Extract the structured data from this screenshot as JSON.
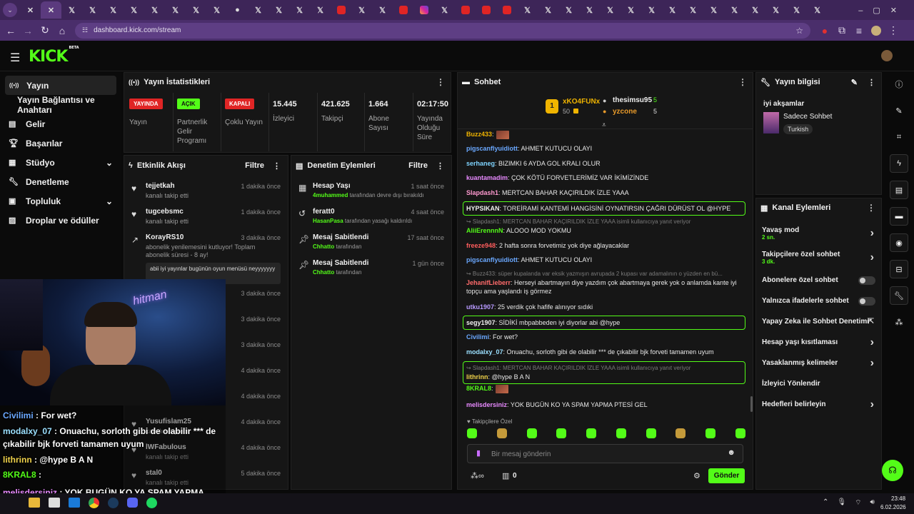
{
  "browser": {
    "tabs": [
      {
        "icon": "tab-icon",
        "g": "✕"
      },
      {
        "icon": "tab-icon",
        "g": "✕"
      },
      {
        "icon": "x-tab-icon",
        "g": "𝕏"
      },
      {
        "icon": "x-tab-icon",
        "g": "𝕏"
      },
      {
        "icon": "x-tab-icon",
        "g": "𝕏"
      },
      {
        "icon": "x-tab-icon",
        "g": "𝕏"
      },
      {
        "icon": "x-tab-icon",
        "g": "𝕏"
      },
      {
        "icon": "x-tab-icon",
        "g": "𝕏"
      },
      {
        "icon": "x-tab-icon",
        "g": "𝕏"
      },
      {
        "icon": "x-tab-icon",
        "g": "𝕏"
      },
      {
        "icon": "avatar-tab-icon",
        "g": "●"
      },
      {
        "icon": "x-tab-icon",
        "g": "𝕏"
      },
      {
        "icon": "x-tab-icon",
        "g": "𝕏"
      },
      {
        "icon": "x-tab-icon",
        "g": "𝕏"
      },
      {
        "icon": "x-tab-icon",
        "g": "𝕏"
      },
      {
        "icon": "youtube-tab-icon",
        "g": "yt"
      },
      {
        "icon": "x-tab-icon",
        "g": "𝕏"
      },
      {
        "icon": "x-tab-icon",
        "g": "𝕏"
      },
      {
        "icon": "youtube-tab-icon",
        "g": "yt"
      },
      {
        "icon": "instagram-tab-icon",
        "g": "ig"
      },
      {
        "icon": "x-tab-icon",
        "g": "𝕏"
      },
      {
        "icon": "youtube-tab-icon",
        "g": "yt"
      },
      {
        "icon": "youtube-tab-icon",
        "g": "yt"
      },
      {
        "icon": "youtube-tab-icon",
        "g": "yt"
      },
      {
        "icon": "x-tab-icon",
        "g": "𝕏"
      },
      {
        "icon": "x-tab-icon",
        "g": "𝕏"
      },
      {
        "icon": "x-tab-icon",
        "g": "𝕏"
      },
      {
        "icon": "x-tab-icon",
        "g": "𝕏"
      },
      {
        "icon": "x-tab-icon",
        "g": "𝕏"
      },
      {
        "icon": "x-tab-icon",
        "g": "𝕏"
      },
      {
        "icon": "x-tab-icon",
        "g": "𝕏"
      },
      {
        "icon": "x-tab-icon",
        "g": "𝕏"
      },
      {
        "icon": "x-tab-icon",
        "g": "𝕏"
      },
      {
        "icon": "x-tab-icon",
        "g": "𝕏"
      },
      {
        "icon": "x-tab-icon",
        "g": "𝕏"
      },
      {
        "icon": "x-tab-icon",
        "g": "𝕏"
      },
      {
        "icon": "x-tab-icon",
        "g": "𝕏"
      },
      {
        "icon": "x-tab-icon",
        "g": "𝕏"
      },
      {
        "icon": "x-tab-icon",
        "g": "𝕏"
      },
      {
        "icon": "new-tab-icon",
        "g": "+"
      }
    ],
    "url": "dashboard.kick.com/stream"
  },
  "app": {
    "logo": "KICK",
    "logo_beta": "BETA"
  },
  "sidebar": {
    "items": [
      {
        "label": "Yayın",
        "icon": "broadcast-icon",
        "glyph": "((•))",
        "active": true
      },
      {
        "label": "Yayın Bağlantısı ve Anahtarı",
        "icon": "",
        "glyph": ""
      },
      {
        "label": "Gelir",
        "icon": "chart-icon",
        "glyph": "▤"
      },
      {
        "label": "Başarılar",
        "icon": "trophy-icon",
        "glyph": "🏆︎"
      },
      {
        "label": "Stüdyo",
        "icon": "studio-icon",
        "glyph": "▦",
        "chevron": "⌄"
      },
      {
        "label": "Denetleme",
        "icon": "wrench-icon",
        "glyph": "🔧︎"
      },
      {
        "label": "Topluluk",
        "icon": "community-icon",
        "glyph": "▣",
        "chevron": "⌄"
      },
      {
        "label": "Droplar ve ödüller",
        "icon": "gift-icon",
        "glyph": "▨"
      }
    ]
  },
  "stats": {
    "title": "Yayın İstatistikleri",
    "items": [
      {
        "badge": "YAYINDA",
        "badge_color": "#e02525",
        "label": "Yayın"
      },
      {
        "badge": "AÇIK",
        "badge_color": "#53fc18",
        "label": "Partnerlik Gelir Programı"
      },
      {
        "badge": "KAPALI",
        "badge_color": "#e02525",
        "label": "Çoklu Yayın"
      },
      {
        "value": "15.445",
        "label": "İzleyici"
      },
      {
        "value": "421.625",
        "label": "Takipçi"
      },
      {
        "value": "1.664",
        "label": "Abone Sayısı"
      },
      {
        "value": "02:17:50",
        "label": "Yayında Olduğu Süre"
      }
    ]
  },
  "activity": {
    "title": "Etkinlik Akışı",
    "filter": "Filtre",
    "items": [
      {
        "name": "tejjetkah",
        "sub": "kanalı takip etti",
        "time": "1 dakika önce"
      },
      {
        "name": "tugcebsmc",
        "sub": "kanalı takip etti",
        "time": "1 dakika önce"
      },
      {
        "name": "KorayRS10",
        "sub": "abonelik yenilemesini kutluyor! Toplam abonelik süresi - 8 ay!",
        "time": "3 dakika önce",
        "msg": "abii iyi yayınlar bugünün oyun menüsü neyyyyyyy"
      },
      {
        "time": "3 dakika önce"
      },
      {
        "time": "3 dakika önce"
      },
      {
        "time": "3 dakika önce"
      },
      {
        "time": "4 dakika önce"
      },
      {
        "name": "",
        "sub": "kanalı takip etti",
        "time": "4 dakika önce"
      },
      {
        "name": "Yusufislam25",
        "sub": "kanalı takip etti",
        "time": "4 dakika önce"
      },
      {
        "name": "lWFabulous",
        "sub": "kanalı takip etti",
        "time": "4 dakika önce"
      },
      {
        "name": "stal0",
        "sub": "kanalı takip etti",
        "time": "5 dakika önce"
      }
    ]
  },
  "moderation": {
    "title": "Denetim Eylemleri",
    "filter": "Filtre",
    "items": [
      {
        "title": "Hesap Yaşı",
        "user": "4muhammed",
        "rest": " tarafından devre dışı bırakıldı",
        "time": "1 saat önce",
        "icon": "calendar-icon",
        "glyph": "▦"
      },
      {
        "title": "feratt0",
        "user": "HasanPasa",
        "rest": " tarafından yasağı kaldırıldı",
        "time": "4 saat önce",
        "icon": "undo-icon",
        "glyph": "↺"
      },
      {
        "title": "Mesaj Sabitlendi",
        "user": "Chhatto",
        "rest": " tarafından",
        "time": "17 saat önce",
        "icon": "pin-icon",
        "glyph": "📌︎"
      },
      {
        "title": "Mesaj Sabitlendi",
        "user": "Chhatto",
        "rest": " tarafından",
        "time": "1 gün önce",
        "icon": "pin-icon",
        "glyph": "📌︎"
      }
    ]
  },
  "chat": {
    "title": "Sohbet",
    "leaders": [
      {
        "rank": "1",
        "name": "xKO4FUNx",
        "count": "50"
      },
      {
        "name": "thesimsu95",
        "count": "5"
      },
      {
        "name": "yzcone",
        "count": "5"
      }
    ],
    "messages": [
      {
        "user": "Buzz433",
        "color": "#f0b400",
        "text": ":",
        "emote": true
      },
      {
        "user": "pigscanflyuidiott",
        "color": "#6aa8ff",
        "text": ": AHMET KUTUCU OLAYI"
      },
      {
        "user": "serhaneg",
        "color": "#7fd4ff",
        "text": ": BIZIMKI 6 AYDA GOL KRALI OLUR"
      },
      {
        "user": "kuantamadim",
        "color": "#e88aff",
        "text": ": ÇOK KÖTÜ FORVETLERİMİZ VAR İKİMİZİNDE"
      },
      {
        "user": "Slapdash1",
        "color": "#ff9ad0",
        "text": ": MERTCAN BAHAR KAÇIRILDIK İZLE YAAA"
      },
      {
        "user": "HYPSIKAN",
        "color": "#f0f0f0",
        "text": ": TOREİRAMİ KANTEMİ HANGİSİNİ OYNATIRSIN ÇAĞRI DÜRÜST OL @HYPE",
        "hl": true
      },
      {
        "reply": "↪ Slapdash1: MERTCAN BAHAR KAÇIRILDIK İZLE YAAA isimli kullanıcıya yanıt veriyor",
        "user": "AliiErennnN",
        "color": "#53fc18",
        "text": ": ALOOO MOD YOKMU"
      },
      {
        "user": "freeze948",
        "color": "#ff5d5d",
        "text": ": 2 hafta sonra forvetimiz yok diye ağlayacaklar"
      },
      {
        "user": "pigscanflyuidiott",
        "color": "#6aa8ff",
        "text": ": AHMET KUTUCU OLAYI"
      },
      {
        "reply": "↪ Buzz433: süper kupalarıda var eksik yazmışın avrupada 2 kupası var adamalının o yüzden en bü...",
        "user": "JehanifLieberr",
        "color": "#ff6b6b",
        "text": ": Herseyi abartmayın diye yazdım çok abartmaya gerek yok o anlamda kante iyi topçu ama yaşlandı iş görmez"
      },
      {
        "user": "utku1907",
        "color": "#b89aff",
        "text": ": 25 verdik çok hafife alınıyor sıdıki"
      },
      {
        "user": "segy1907",
        "color": "#f0f0f0",
        "text": ": SİDİKİ mbpabbeden iyi diyorlar abi @hype",
        "hl": true
      },
      {
        "user": "Civilimi",
        "color": "#6aa8ff",
        "text": ": For wet?"
      },
      {
        "user": "modalxy_07",
        "color": "#9be0ff",
        "text": ": Onuachu, sorloth gibi de olabilir *** de çıkabilir bjk forveti tamamen uyum"
      },
      {
        "reply": "↪ Slapdash1: MERTCAN BAHAR KAÇIRILDIK İZLE YAAA isimli kullanıcıya yanıt veriyor",
        "user": "lithrinn",
        "color": "#f0d24a",
        "text": ": @hype B A N",
        "hl": true
      },
      {
        "user": "8KRAL8",
        "color": "#53fc18",
        "text": ":",
        "emote": true
      },
      {
        "user": "melisdersiniz",
        "color": "#e88aff",
        "text": ": YOK BUGÜN KO YA SPAM YAPMA PTESİ GEL"
      }
    ],
    "followers_only": "Takipçilere Özel",
    "input_placeholder": "Bir mesaj gönderin",
    "points": "0",
    "send": "Gönder"
  },
  "overlay_chat": [
    {
      "user": "Civilimi",
      "color": "#6aa8ff",
      "text": " : For wet?"
    },
    {
      "user": "modalxy_07",
      "color": "#9be0ff",
      "text": " : Onuachu, sorloth gibi de olabilir *** de"
    },
    {
      "user": "",
      "color": "#fff",
      "text": "çıkabilir bjk forveti tamamen uyum"
    },
    {
      "user": "lithrinn",
      "color": "#f0d24a",
      "text": " : @hype B A N"
    },
    {
      "user": "8KRAL8",
      "color": "#53fc18",
      "text": " :"
    },
    {
      "user": "melisdersiniz",
      "color": "#e88aff",
      "text": " : YOK BUGÜN KO YA SPAM YAPMA"
    },
    {
      "user": "",
      "color": "#fff",
      "text": "PTESİ GEL"
    }
  ],
  "stream_info": {
    "title": "Yayın bilgisi",
    "stream_title": "iyi akşamlar",
    "category": "Sadece Sohbet",
    "language": "Turkish"
  },
  "channel_actions": {
    "title": "Kanal Eylemleri",
    "items": [
      {
        "label": "Yavaş mod",
        "sub": "2 sn.",
        "type": "chevron"
      },
      {
        "label": "Takipçilere özel sohbet",
        "sub": "3 dk.",
        "type": "chevron"
      },
      {
        "label": "Abonelere özel sohbet",
        "type": "toggle"
      },
      {
        "label": "Yalnızca ifadelerle sohbet",
        "type": "toggle"
      },
      {
        "label": "Yapay Zeka ile Sohbet Denetimi",
        "type": "external"
      },
      {
        "label": "Hesap yaşı kısıtlaması",
        "type": "chevron"
      },
      {
        "label": "Yasaklanmış kelimeler",
        "type": "chevron"
      },
      {
        "label": "İzleyici Yönlendir",
        "type": "none"
      },
      {
        "label": "Hedefleri belirleyin",
        "type": "chevron"
      }
    ]
  },
  "rightbar": [
    "info-icon",
    "edit-icon",
    "screen-icon",
    "bolt-icon",
    "card-icon",
    "chat-icon",
    "broadcast-icon",
    "layout-icon",
    "wrench-icon",
    "apps-icon"
  ],
  "taskbar": {
    "time": "23:48",
    "date": "6.02.2026"
  },
  "colors": {
    "accent": "#53fc18",
    "browser": "#3d2558",
    "panel": "#161616"
  }
}
